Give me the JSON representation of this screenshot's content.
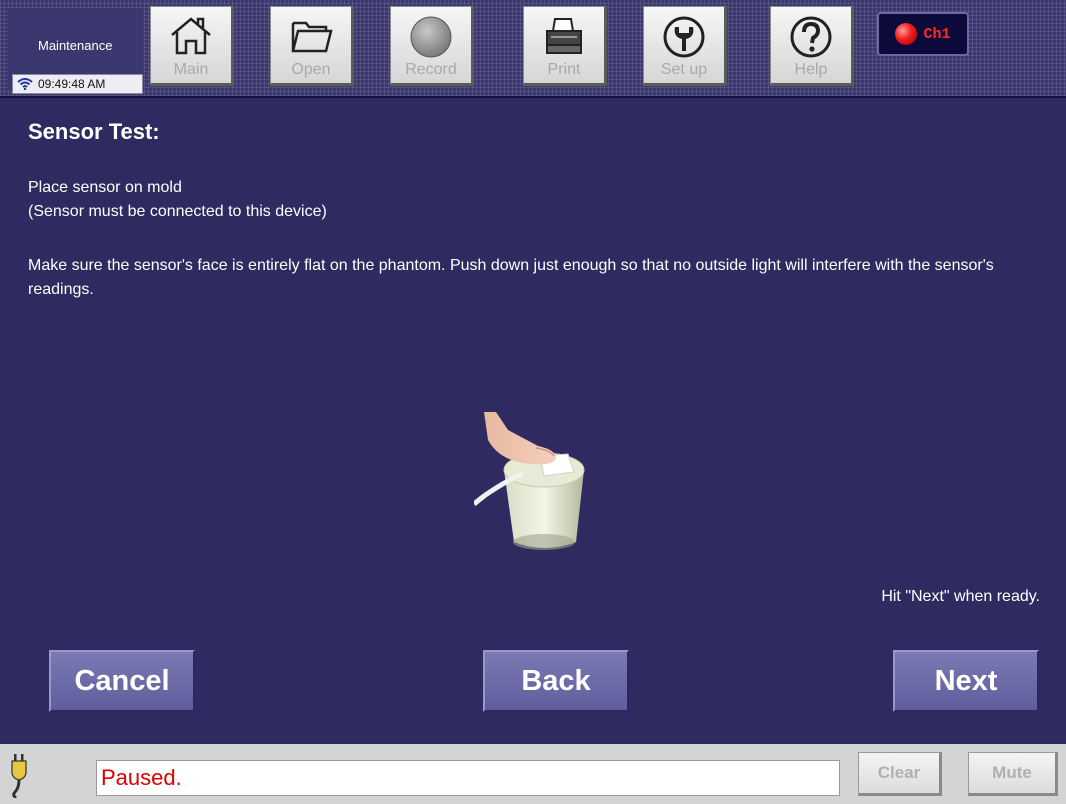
{
  "toolbar": {
    "mode_label": "Maintenance",
    "clock": "09:49:48 AM",
    "buttons": {
      "main": "Main",
      "open": "Open",
      "record": "Record",
      "print": "Print",
      "setup": "Set up",
      "help": "Help"
    },
    "channel": {
      "label": "Ch1",
      "status_color": "#f01a1a"
    }
  },
  "main": {
    "title": "Sensor Test:",
    "instruction_1": "Place sensor on mold",
    "instruction_2": "(Sensor must be connected to this device)",
    "instruction_3": "Make sure the sensor's face is entirely flat on the phantom. Push down just enough so that no outside light will interfere with the sensor's readings.",
    "ready_hint": "Hit \"Next\" when ready.",
    "buttons": {
      "cancel": "Cancel",
      "back": "Back",
      "next": "Next"
    }
  },
  "statusbar": {
    "status_text": "Paused.",
    "clear": "Clear",
    "mute": "Mute"
  },
  "colors": {
    "background": "#2f2b60",
    "nav_button": "#6c6aa8",
    "status_text": "#e00000"
  },
  "icons": [
    "wifi-icon",
    "home-icon",
    "folder-icon",
    "record-icon",
    "printer-icon",
    "wrench-icon",
    "help-icon",
    "plug-icon"
  ]
}
